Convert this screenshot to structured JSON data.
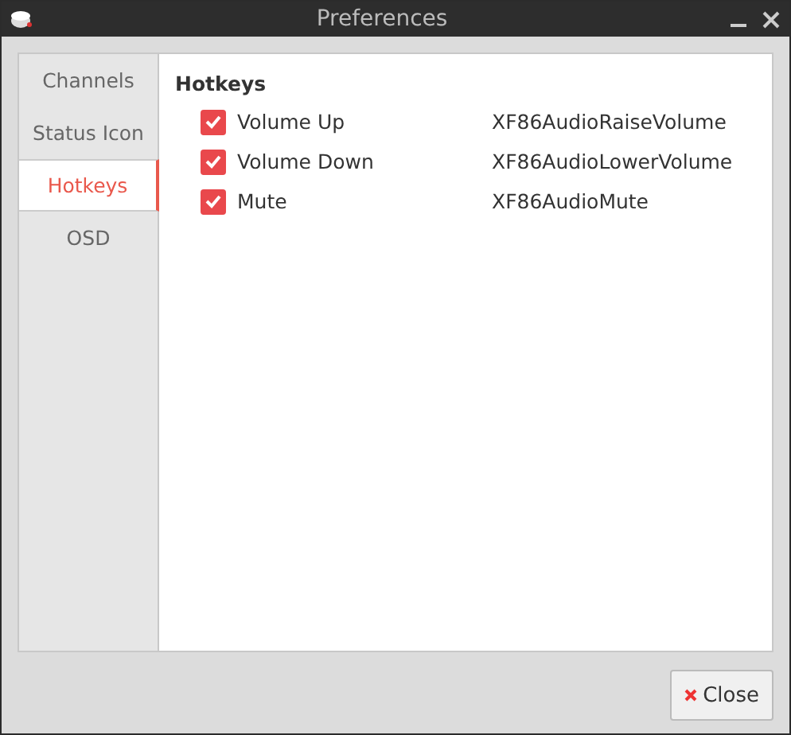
{
  "window": {
    "title": "Preferences"
  },
  "tabs": [
    {
      "label": "Channels",
      "selected": false
    },
    {
      "label": "Status Icon",
      "selected": false
    },
    {
      "label": "Hotkeys",
      "selected": true
    },
    {
      "label": "OSD",
      "selected": false
    }
  ],
  "section_title": "Hotkeys",
  "hotkeys": [
    {
      "label": "Volume Up",
      "checked": true,
      "key": "XF86AudioRaiseVolume"
    },
    {
      "label": "Volume Down",
      "checked": true,
      "key": "XF86AudioLowerVolume"
    },
    {
      "label": "Mute",
      "checked": true,
      "key": "XF86AudioMute"
    }
  ],
  "buttons": [
    {
      "label": "Close",
      "kind": "close"
    }
  ]
}
